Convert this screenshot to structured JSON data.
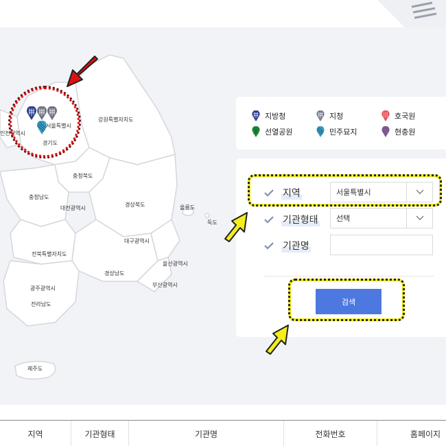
{
  "map": {
    "regions": {
      "gangwon": "강원특별자치도",
      "incheon": "인천광역시",
      "seoul": "서울특별시",
      "gyeonggi": "경기도",
      "chungbuk": "충청북도",
      "chungnam": "충청남도",
      "daejeon": "대전광역시",
      "gyeongbuk": "경상북도",
      "ulleungdo": "울릉도",
      "dokdo": "독도",
      "daegu": "대구광역시",
      "jeonbuk": "전북특별자치도",
      "ulsan": "울산광역시",
      "gyeongnam": "경상남도",
      "busan": "부산광역시",
      "gwangju": "광주광역시",
      "jeonnam": "전라남도",
      "jeju": "제주도"
    }
  },
  "legend": {
    "items": [
      {
        "label": "지방청",
        "icon": "local-office-icon",
        "color": "#2a3d8f"
      },
      {
        "label": "지청",
        "icon": "branch-office-icon",
        "color": "#7a7d8a"
      },
      {
        "label": "호국원",
        "icon": "national-memorial-icon",
        "color": "#e24a55"
      },
      {
        "label": "선열공원",
        "icon": "patriots-park-icon",
        "color": "#1e8a3a"
      },
      {
        "label": "민주묘지",
        "icon": "democracy-cemetery-icon",
        "color": "#3a9bc1"
      },
      {
        "label": "현충원",
        "icon": "national-cemetery-icon",
        "color": "#7b5a8c"
      }
    ]
  },
  "search": {
    "region_label": "지역",
    "region_value": "서울특별시",
    "type_label": "기관형태",
    "type_value": "선택",
    "name_label": "기관명",
    "name_value": "",
    "button_label": "검색"
  },
  "table": {
    "headers": [
      "지역",
      "기관형태",
      "기관명",
      "전화번호",
      "홈페이지"
    ]
  },
  "colors": {
    "accent": "#4d78e0",
    "map_bg": "#f2f3f6",
    "annotation_red": "#e01010",
    "annotation_yellow": "#f4ee1c"
  }
}
